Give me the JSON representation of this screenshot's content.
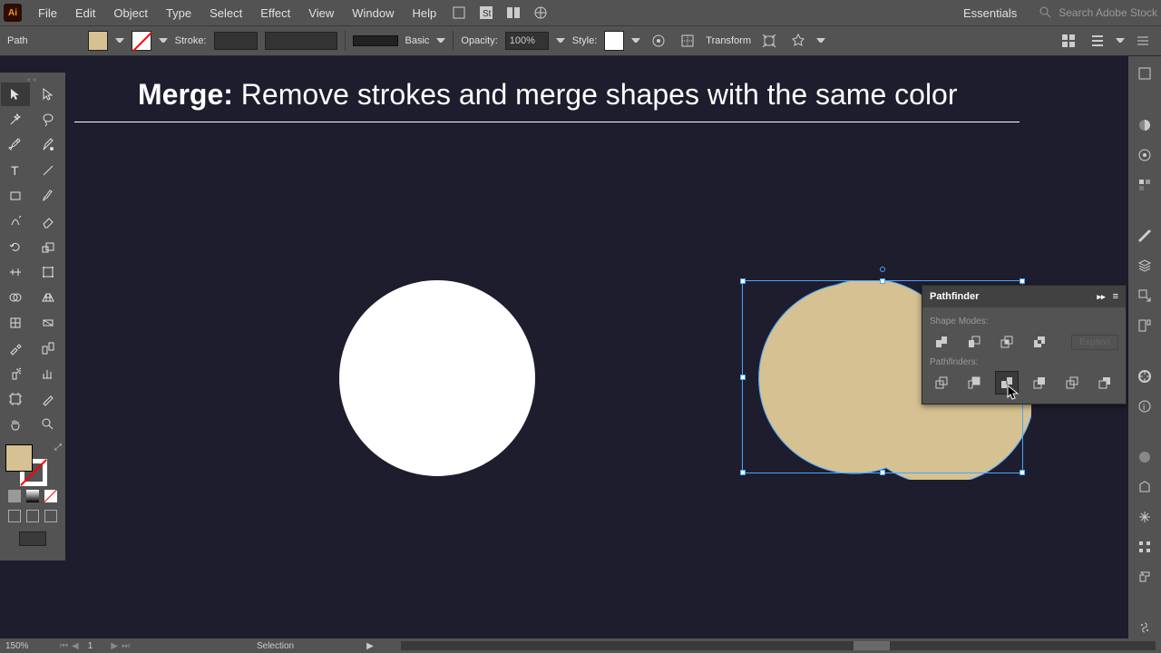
{
  "menu": {
    "items": [
      "File",
      "Edit",
      "Object",
      "Type",
      "Select",
      "Effect",
      "View",
      "Window",
      "Help"
    ],
    "workspace": "Essentials",
    "search_placeholder": "Search Adobe Stock"
  },
  "control": {
    "selection_label": "Path",
    "stroke_label": "Stroke:",
    "stroke_weight": "",
    "brush": "Basic",
    "opacity_label": "Opacity:",
    "opacity": "100%",
    "style_label": "Style:",
    "transform": "Transform"
  },
  "canvas": {
    "title_bold": "Merge:",
    "title_rest": "Remove strokes and merge shapes with the same color"
  },
  "pathfinder": {
    "title": "Pathfinder",
    "shape_modes": "Shape Modes:",
    "pathfinders": "Pathfinders:",
    "expand": "Expand"
  },
  "status": {
    "zoom": "150%",
    "page": "1",
    "tool": "Selection"
  },
  "colors": {
    "fill": "#d5c191",
    "white": "#ffffff",
    "canvas": "#1d1d2e"
  }
}
